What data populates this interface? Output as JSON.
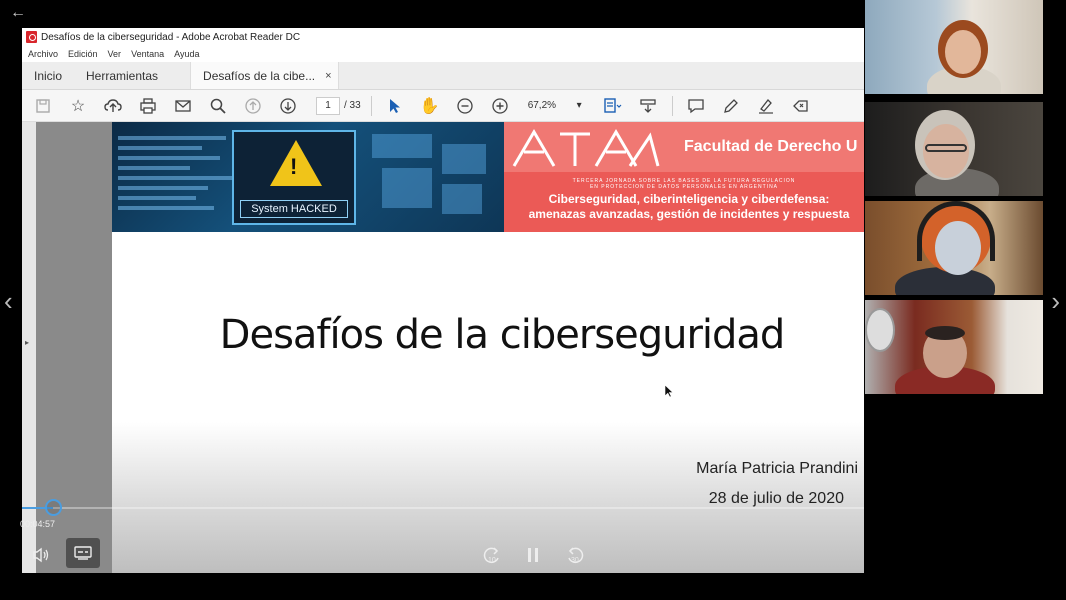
{
  "window": {
    "title": "Desafíos de la ciberseguridad - Adobe Acrobat Reader DC"
  },
  "menu": [
    "Archivo",
    "Edición",
    "Ver",
    "Ventana",
    "Ayuda"
  ],
  "tabs": {
    "home": "Inicio",
    "tools": "Herramientas",
    "document": "Desafíos de la cibe...",
    "close": "×"
  },
  "toolbar": {
    "page_current": "1",
    "page_total": "/ 33",
    "zoom": "67,2%",
    "icons": [
      "save-icon",
      "bookmark-star-icon",
      "upload-icon",
      "print-icon",
      "email-icon",
      "search-icon",
      "page-up-icon",
      "page-down-icon",
      "select-cursor-icon",
      "hand-icon",
      "zoom-out-icon",
      "zoom-in-icon",
      "zoom-dropdown-icon",
      "scroll-mode-icon",
      "read-mode-icon",
      "comment-icon",
      "pen-icon",
      "sign-icon",
      "share-icon"
    ]
  },
  "slide": {
    "banner_left_label": "System HACKED",
    "banner_right_title": "Facultad de Derecho U",
    "banner_jornada_line1": "TERCERA JORNADA SOBRE LAS BASES DE LA FUTURA REGULACION",
    "banner_jornada_line2": "EN PROTECCION DE DATOS PERSONALES EN ARGENTINA",
    "banner_sub_line1": "Ciberseguridad, ciberinteligencia y ciberdefensa:",
    "banner_sub_line2": "amenazas avanzadas, gestión de incidentes y respuesta",
    "title": "Desafíos de la ciberseguridad",
    "author": "María Patricia Prandini",
    "date": "28 de julio de 2020"
  },
  "player": {
    "time": "00:04:57",
    "progress_fraction": 0.037
  },
  "colors": {
    "accent": "#4a9de0",
    "banner_red": "#eb5a56",
    "banner_blue": "#14507a",
    "acrobat_red": "#d8262c"
  }
}
